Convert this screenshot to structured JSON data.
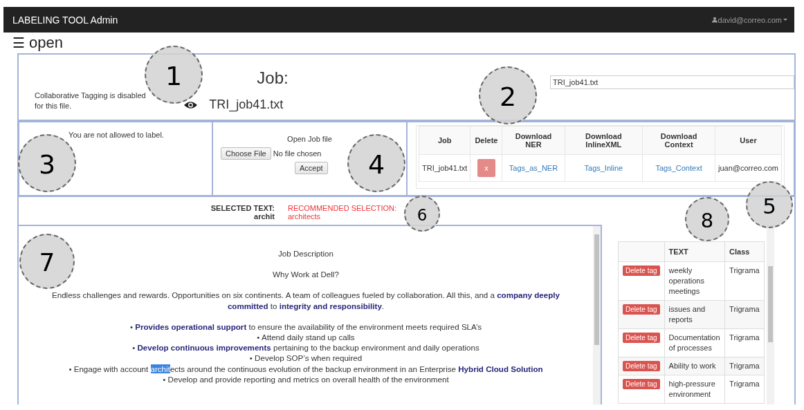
{
  "navbar": {
    "title": "LABELING TOOL Admin",
    "user": "david@correo.com"
  },
  "page_heading": {
    "menu_glyph": "☰",
    "title": "open"
  },
  "job_panel": {
    "collab_note": "Collaborative Tagging is disabled for this file.",
    "job_label": "Job:",
    "filename": "TRI_job41.txt",
    "job_field": "TRI_job41.txt"
  },
  "permission_panel": {
    "message": "You are not allowed to label."
  },
  "open_panel": {
    "title": "Open Job file",
    "choose_button": "Choose File",
    "file_status": "No file chosen",
    "accept_button": "Accept"
  },
  "jobs_table": {
    "columns": [
      "Job",
      "Delete",
      "Download NER",
      "Download InlineXML",
      "Download Context",
      "User"
    ],
    "rows": [
      {
        "job": "TRI_job41.txt",
        "delete": "x",
        "ner": "Tags_as_NER",
        "inline": "Tags_Inline",
        "context": "Tags_Context",
        "user": "juan@correo.com"
      }
    ]
  },
  "selection": {
    "label": "SELECTED TEXT:",
    "value": "archit",
    "recommended_label": "RECOMMENDED SELECTION:",
    "recommended_value": "architects"
  },
  "document": {
    "paragraphs": [
      {
        "lines": [
          [
            {
              "kind": "plain",
              "text": "Job Description"
            }
          ]
        ]
      },
      {
        "lines": [
          [
            {
              "kind": "plain",
              "text": "Why Work at Dell?"
            }
          ]
        ]
      },
      {
        "lines": [
          [
            {
              "kind": "plain",
              "text": "Endless challenges and rewards. Opportunities on six continents. A team of colleagues fueled by collaboration. All this, and a "
            },
            {
              "kind": "tag",
              "text": "company deeply committed"
            },
            {
              "kind": "plain",
              "text": " to "
            },
            {
              "kind": "tag",
              "text": "integrity and responsibility"
            },
            {
              "kind": "plain",
              "text": "."
            }
          ]
        ]
      },
      {
        "lines": [
          [
            {
              "kind": "plain",
              "text": "• "
            },
            {
              "kind": "tag",
              "text": "Provides operational support"
            },
            {
              "kind": "plain",
              "text": " to ensure the availability of the environment meets required SLA’s"
            }
          ],
          [
            {
              "kind": "plain",
              "text": "• Attend daily stand up calls"
            }
          ],
          [
            {
              "kind": "plain",
              "text": "• "
            },
            {
              "kind": "tag",
              "text": "Develop continuous improvements"
            },
            {
              "kind": "plain",
              "text": " pertaining to the backup environment and daily operations"
            }
          ],
          [
            {
              "kind": "plain",
              "text": "• Develop SOP’s when required"
            }
          ],
          [
            {
              "kind": "plain",
              "text": "• Engage with account "
            },
            {
              "kind": "selection",
              "text": "archit"
            },
            {
              "kind": "plain",
              "text": "ects around the continuous evolution of the backup environment in an Enterprise "
            },
            {
              "kind": "tag",
              "text": "Hybrid Cloud Solution"
            }
          ],
          [
            {
              "kind": "plain",
              "text": "• Develop and provide reporting and metrics on overall health of the environment"
            }
          ]
        ]
      }
    ]
  },
  "tags_table": {
    "columns": [
      "TEXT",
      "Class"
    ],
    "rows": [
      {
        "button": "Delete tag",
        "text": "weekly operations meetings",
        "class": "Trigrama"
      },
      {
        "button": "Delete tag",
        "text": "issues and reports",
        "class": "Trigrama"
      },
      {
        "button": "Delete tag",
        "text": "Documentation of processes",
        "class": "Trigrama"
      },
      {
        "button": "Delete tag",
        "text": "Ability to work",
        "class": "Trigrama"
      },
      {
        "button": "Delete tag",
        "text": "high-pressure environment",
        "class": "Trigrama"
      }
    ]
  },
  "callouts": [
    "1",
    "2",
    "3",
    "4",
    "5",
    "6",
    "7",
    "8"
  ]
}
